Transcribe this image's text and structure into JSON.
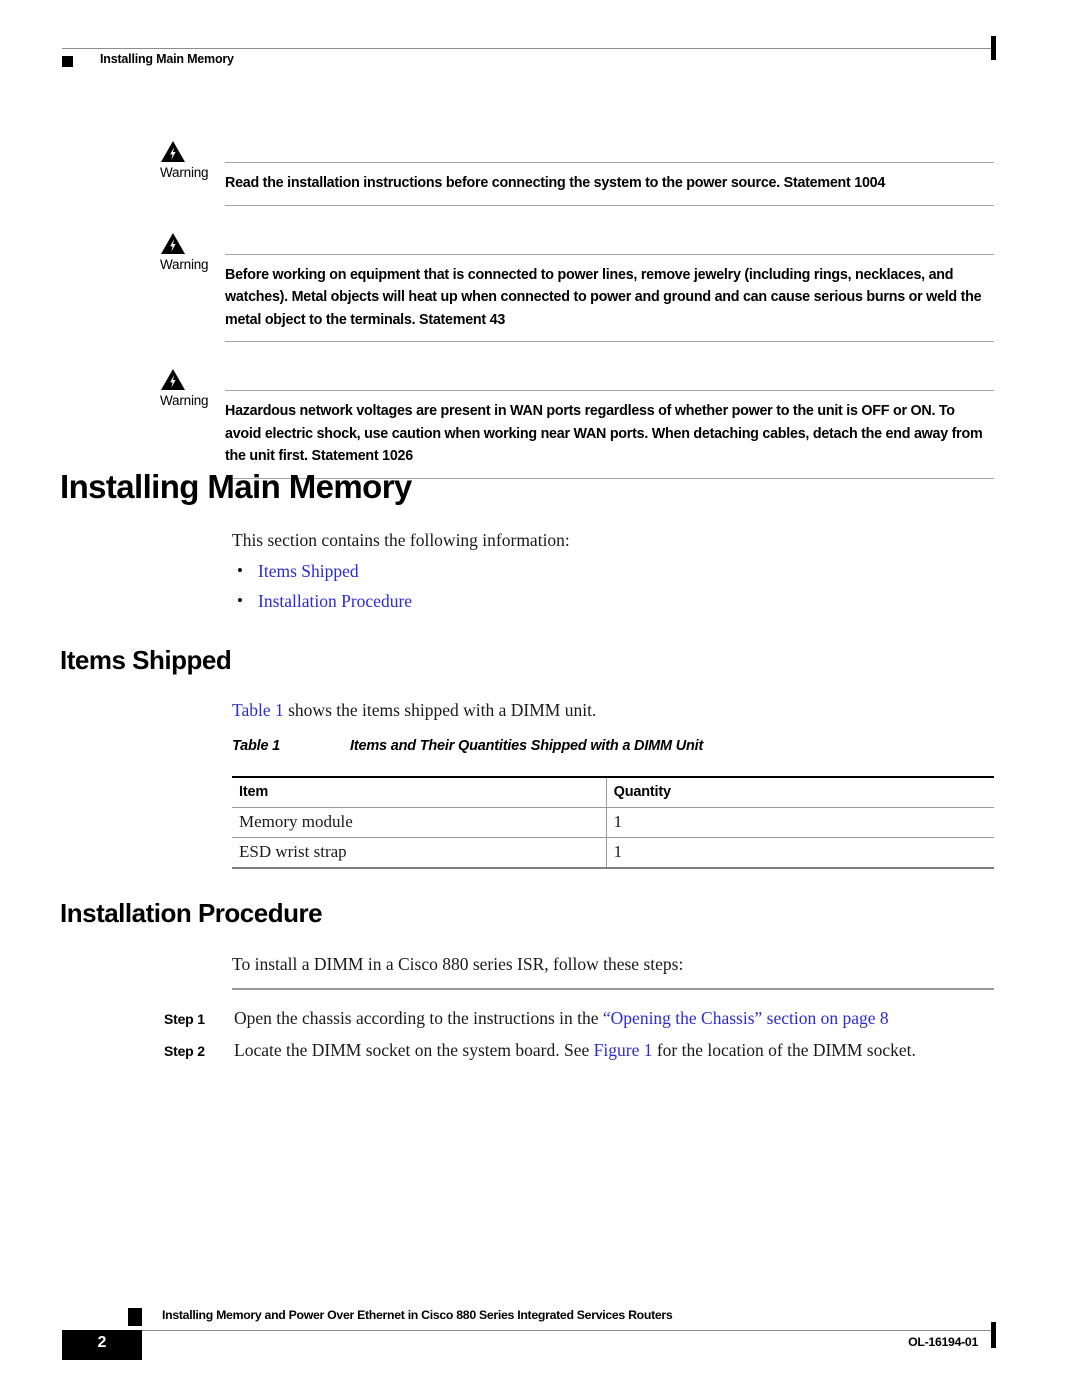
{
  "header": {
    "title": "Installing Main Memory",
    "bullet_icon": "black-square-icon"
  },
  "warnings": [
    {
      "icon": "warning-triangle-lightning-icon",
      "label": "Warning",
      "text": "Read the installation instructions before connecting the system to the power source. Statement 1004"
    },
    {
      "icon": "warning-triangle-lightning-icon",
      "label": "Warning",
      "text": "Before working on equipment that is connected to power lines, remove jewelry (including rings, necklaces, and watches). Metal objects will heat up when connected to power and ground and can cause serious burns or weld the metal object to the terminals. Statement 43"
    },
    {
      "icon": "warning-triangle-lightning-icon",
      "label": "Warning",
      "text": "Hazardous network voltages are present in WAN ports regardless of whether power to the unit is OFF or ON. To avoid electric shock, use caution when working near WAN ports. When detaching cables, detach the end away from the unit first. Statement 1026"
    }
  ],
  "main_section": {
    "heading": "Installing Main Memory",
    "intro": "This section contains the following information:",
    "links": [
      {
        "bullet": "•",
        "label": "Items Shipped"
      },
      {
        "bullet": "•",
        "label": "Installation Procedure"
      }
    ]
  },
  "items_shipped": {
    "heading": "Items Shipped",
    "intro_link": "Table 1",
    "intro_rest": " shows the items shipped with a DIMM unit.",
    "table": {
      "caption_number": "Table 1",
      "caption_title": "Items and Their Quantities Shipped with a DIMM Unit",
      "columns": [
        "Item",
        "Quantity"
      ],
      "rows": [
        [
          "Memory module",
          "1"
        ],
        [
          "ESD wrist strap",
          "1"
        ]
      ]
    }
  },
  "installation_procedure": {
    "heading": "Installation Procedure",
    "intro": "To install a DIMM in a Cisco 880 series ISR, follow these steps:",
    "steps": [
      {
        "label": "Step 1",
        "text_before": "Open the chassis according to the instructions in the ",
        "link": "“Opening the Chassis” section on page 8",
        "text_after": ""
      },
      {
        "label": "Step 2",
        "text_before": "Locate the DIMM socket on the system board. See ",
        "link": "Figure 1",
        "text_after": " for the location of the DIMM socket."
      }
    ]
  },
  "footer": {
    "bullet_icon": "black-square-icon",
    "title": "Installing Memory and Power Over Ethernet in Cisco 880 Series Integrated Services Routers",
    "page_number": "2",
    "doc_number": "OL-16194-01"
  },
  "colors": {
    "link": "#2b2bd4",
    "text": "#1a1a1a",
    "rule": "#9a9a9a",
    "black": "#000000"
  }
}
